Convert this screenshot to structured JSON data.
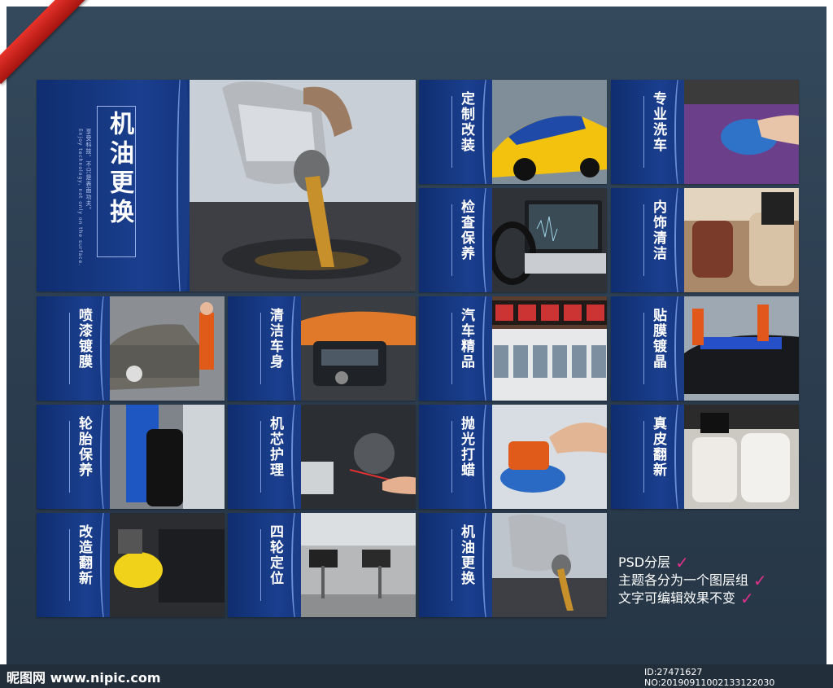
{
  "large_panel": {
    "title": "机油更换",
    "subtitle_zh": "享受科技，不只是表面功夫。",
    "subtitle_en": "Enjoy technology, not only on the surface."
  },
  "panels": [
    {
      "title": "定制改装",
      "photo": "yellow-race-car"
    },
    {
      "title": "专业洗车",
      "photo": "car-washing-sponge"
    },
    {
      "title": "检查保养",
      "photo": "laptop-diagnostics"
    },
    {
      "title": "内饰清洁",
      "photo": "car-interior-seats"
    },
    {
      "title": "喷漆镀膜",
      "photo": "mechanic-painting-car"
    },
    {
      "title": "清洁车身",
      "photo": "cleaning-dashboard"
    },
    {
      "title": "汽车精品",
      "photo": "accessory-store-shelves"
    },
    {
      "title": "贴膜镀晶",
      "photo": "workers-wrapping-car"
    },
    {
      "title": "轮胎保养",
      "photo": "mechanic-holding-tire"
    },
    {
      "title": "机芯护理",
      "photo": "engine-bay-diagnostics"
    },
    {
      "title": "抛光打蜡",
      "photo": "polishing-machine"
    },
    {
      "title": "真皮翻新",
      "photo": "leather-seats"
    },
    {
      "title": "改造翻新",
      "photo": "yellow-polishing-pad"
    },
    {
      "title": "四轮定位",
      "photo": "repair-workshop-lifts"
    },
    {
      "title": "机油更换",
      "photo": "oil-pouring"
    }
  ],
  "notes": {
    "line1": "PSD分层",
    "line2": "主题各分为一个图层组",
    "line3": "文字可编辑效果不变"
  },
  "footer": {
    "logo": "昵图网 www.nipic.com",
    "id": "ID:27471627 NO:20190911002133122030"
  },
  "colors": {
    "background": "#2c3e50",
    "panel_blue": "#13337a",
    "check": "#e0308a",
    "ribbon": "#d6241e"
  }
}
